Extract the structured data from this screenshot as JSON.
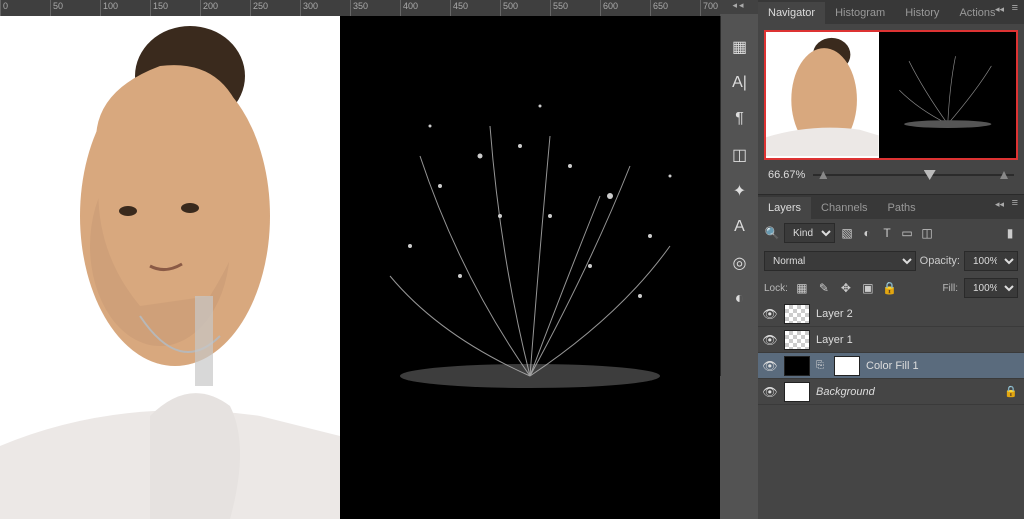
{
  "ruler": {
    "start": 0,
    "step": 50,
    "count": 24
  },
  "tools": [
    {
      "name": "properties-icon",
      "glyph": "▦"
    },
    {
      "name": "character-icon",
      "glyph": "A|"
    },
    {
      "name": "paragraph-icon",
      "glyph": "¶"
    },
    {
      "name": "3d-icon",
      "glyph": "◫"
    },
    {
      "name": "settings-icon",
      "glyph": "✦"
    },
    {
      "name": "glyphs-icon",
      "glyph": "A"
    },
    {
      "name": "libraries-icon",
      "glyph": "◎"
    },
    {
      "name": "adjustments-icon",
      "glyph": "◐"
    }
  ],
  "nav_tabs": {
    "items": [
      {
        "label": "Navigator",
        "active": true
      },
      {
        "label": "Histogram",
        "active": false
      },
      {
        "label": "History",
        "active": false
      },
      {
        "label": "Actions",
        "active": false
      }
    ]
  },
  "navigator": {
    "zoom": "66.67%"
  },
  "layer_tabs": {
    "items": [
      {
        "label": "Layers",
        "active": true
      },
      {
        "label": "Channels",
        "active": false
      },
      {
        "label": "Paths",
        "active": false
      }
    ]
  },
  "layers_opts": {
    "filter_label": "Kind",
    "blend_mode": "Normal",
    "opacity_label": "Opacity:",
    "opacity_value": "100%",
    "lock_label": "Lock:",
    "fill_label": "Fill:",
    "fill_value": "100%"
  },
  "layers": [
    {
      "name": "Layer 2",
      "thumb": "checker",
      "selected": false,
      "mask": false,
      "locked": false,
      "italic": false
    },
    {
      "name": "Layer 1",
      "thumb": "checker",
      "selected": false,
      "mask": false,
      "locked": false,
      "italic": false
    },
    {
      "name": "Color Fill 1",
      "thumb": "black",
      "selected": true,
      "mask": true,
      "locked": false,
      "italic": false
    },
    {
      "name": "Background",
      "thumb": "white",
      "selected": false,
      "mask": false,
      "locked": true,
      "italic": true
    }
  ],
  "colors": {
    "panel": "#454545",
    "accent": "#d33"
  }
}
